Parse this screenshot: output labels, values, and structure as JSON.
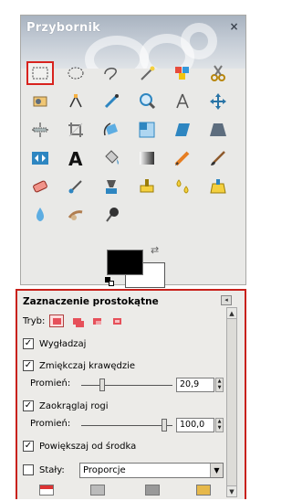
{
  "toolbox": {
    "title": "Przybornik",
    "close_symbol": "×",
    "tools": [
      {
        "name": "rect-select-icon"
      },
      {
        "name": "ellipse-select-icon"
      },
      {
        "name": "free-select-icon"
      },
      {
        "name": "fuzzy-select-icon"
      },
      {
        "name": "color-select-icon"
      },
      {
        "name": "scissors-select-icon"
      },
      {
        "name": "foreground-select-icon"
      },
      {
        "name": "paths-icon"
      },
      {
        "name": "color-picker-icon"
      },
      {
        "name": "zoom-icon"
      },
      {
        "name": "measure-icon"
      },
      {
        "name": "move-icon"
      },
      {
        "name": "align-icon"
      },
      {
        "name": "crop-icon"
      },
      {
        "name": "rotate-icon"
      },
      {
        "name": "scale-icon"
      },
      {
        "name": "shear-icon"
      },
      {
        "name": "perspective-icon"
      },
      {
        "name": "flip-icon"
      },
      {
        "name": "text-icon"
      },
      {
        "name": "bucket-fill-icon"
      },
      {
        "name": "blend-icon"
      },
      {
        "name": "pencil-icon"
      },
      {
        "name": "paintbrush-icon"
      },
      {
        "name": "eraser-icon"
      },
      {
        "name": "airbrush-icon"
      },
      {
        "name": "ink-icon"
      },
      {
        "name": "clone-icon"
      },
      {
        "name": "heal-icon"
      },
      {
        "name": "perspective-clone-icon"
      },
      {
        "name": "blur-icon"
      },
      {
        "name": "smudge-icon"
      },
      {
        "name": "dodge-burn-icon"
      }
    ],
    "active_tool_index": 0,
    "foreground_color": "#000000",
    "background_color": "#ffffff"
  },
  "options": {
    "title": "Zaznaczenie prostokątne",
    "mode_label": "Tryb:",
    "mode_icons": [
      "replace-mode-icon",
      "add-mode-icon",
      "subtract-mode-icon",
      "intersect-mode-icon"
    ],
    "antialias": {
      "label": "Wygładzaj",
      "checked": true
    },
    "feather": {
      "label": "Zmiękczaj krawędzie",
      "checked": true
    },
    "feather_radius": {
      "label": "Promień:",
      "value": "20,9"
    },
    "rounded": {
      "label": "Zaokrąglaj rogi",
      "checked": true
    },
    "rounded_radius": {
      "label": "Promień:",
      "value": "100,0"
    },
    "expand": {
      "label": "Powiększaj od środka",
      "checked": true
    },
    "fixed": {
      "label": "Stały:",
      "checked": false,
      "selected": "Proporcje"
    },
    "check_mark": "✓",
    "accent_color": "#c8211b"
  }
}
